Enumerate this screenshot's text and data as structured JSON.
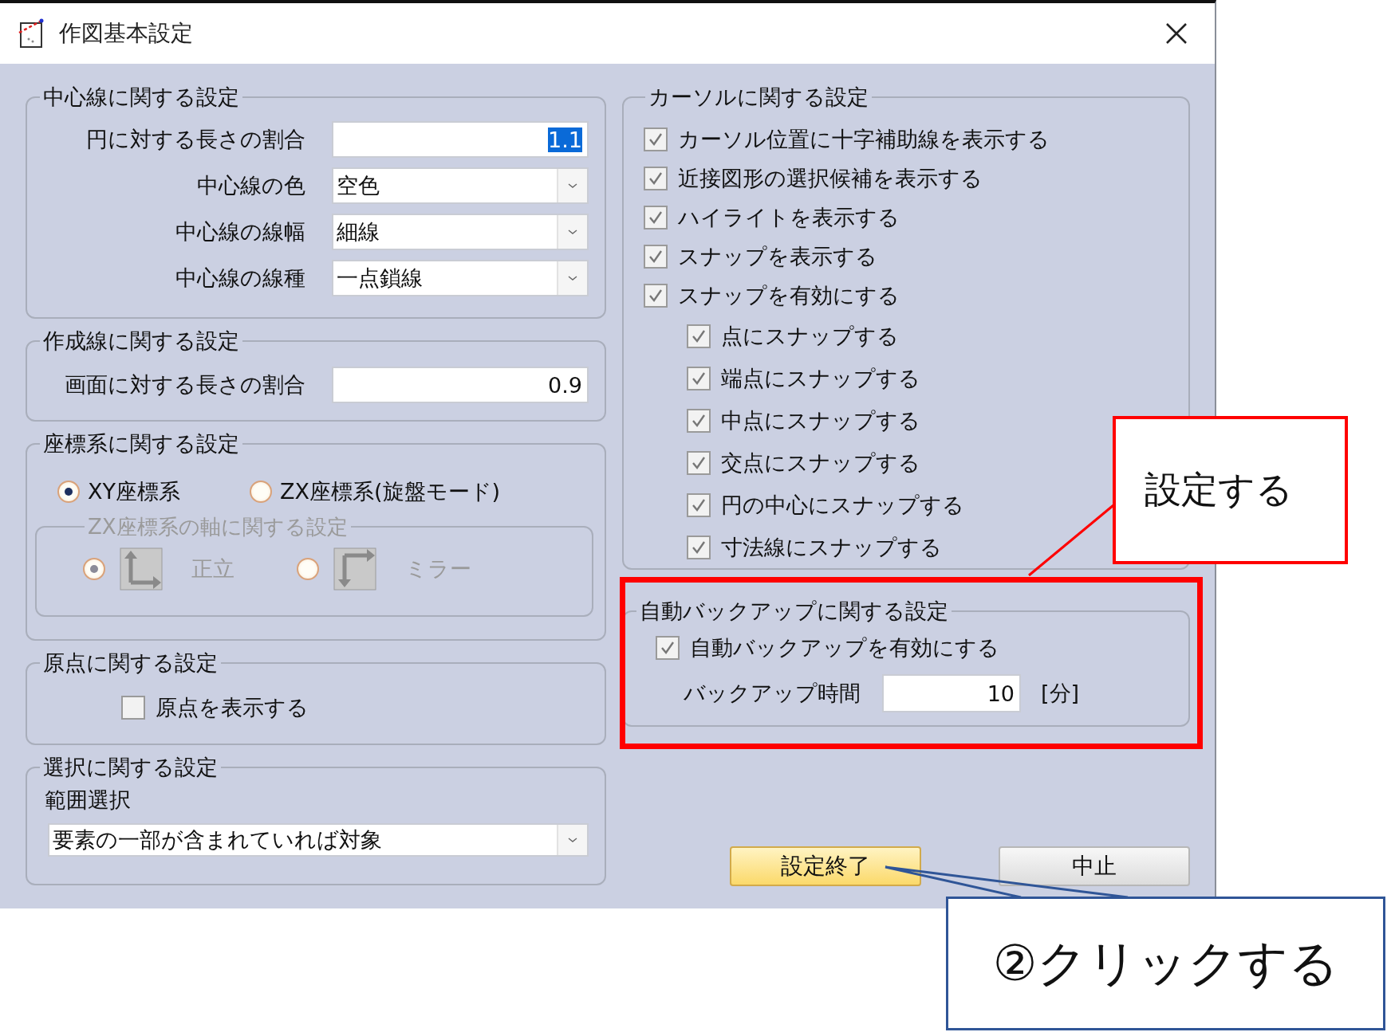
{
  "window": {
    "title": "作図基本設定"
  },
  "center_line": {
    "title": "中心線に関する設定",
    "rows": [
      {
        "label": "円に対する長さの割合",
        "kind": "text",
        "value": "1.1",
        "value_selected": true
      },
      {
        "label": "中心線の色",
        "kind": "combo",
        "value": "空色"
      },
      {
        "label": "中心線の線幅",
        "kind": "combo",
        "value": "細線"
      },
      {
        "label": "中心線の線種",
        "kind": "combo",
        "value": "一点鎖線"
      }
    ]
  },
  "creation_line": {
    "title": "作成線に関する設定",
    "rows": [
      {
        "label": "画面に対する長さの割合",
        "kind": "text",
        "value": "0.9",
        "value_selected": false
      }
    ]
  },
  "coordinates": {
    "title": "座標系に関する設定",
    "options": [
      {
        "label": "XY座標系",
        "selected": true
      },
      {
        "label": "ZX座標系(旋盤モード)",
        "selected": false
      }
    ],
    "axis_group": {
      "title": "ZX座標系の軸に関する設定",
      "disabled": true,
      "options": [
        {
          "label": "正立",
          "kind": "upright",
          "selected": true
        },
        {
          "label": "ミラー",
          "kind": "mirror",
          "selected": false
        }
      ]
    }
  },
  "origin": {
    "title": "原点に関する設定",
    "checkbox": {
      "label": "原点を表示する",
      "checked": false
    }
  },
  "selection": {
    "title": "選択に関する設定",
    "label": "範囲選択",
    "combo": {
      "value": "要素の一部が含まれていれば対象"
    }
  },
  "cursor": {
    "title": "カーソルに関する設定",
    "items": [
      {
        "label": "カーソル位置に十字補助線を表示する",
        "checked": true
      },
      {
        "label": "近接図形の選択候補を表示する",
        "checked": true
      },
      {
        "label": "ハイライトを表示する",
        "checked": true
      },
      {
        "label": "スナップを表示する",
        "checked": true
      },
      {
        "label": "スナップを有効にする",
        "checked": true,
        "children": [
          {
            "label": "点にスナップする",
            "checked": true
          },
          {
            "label": "端点にスナップする",
            "checked": true
          },
          {
            "label": "中点にスナップする",
            "checked": true
          },
          {
            "label": "交点にスナップする",
            "checked": true
          },
          {
            "label": "円の中心にスナップする",
            "checked": true
          },
          {
            "label": "寸法線にスナップする",
            "checked": true
          }
        ]
      }
    ]
  },
  "backup": {
    "title": "自動バックアップに関する設定",
    "checkbox": {
      "label": "自動バックアップを有効にする",
      "checked": true
    },
    "interval": {
      "label": "バックアップ時間",
      "value": "10",
      "unit": "[分]"
    }
  },
  "buttons": [
    {
      "label": "設定終了",
      "kind": "primary"
    },
    {
      "label": "中止",
      "kind": "normal"
    }
  ],
  "callouts": [
    {
      "text": "設定する",
      "color": "#ff0000"
    },
    {
      "text": "②クリックする",
      "color": "#2f5597"
    }
  ]
}
